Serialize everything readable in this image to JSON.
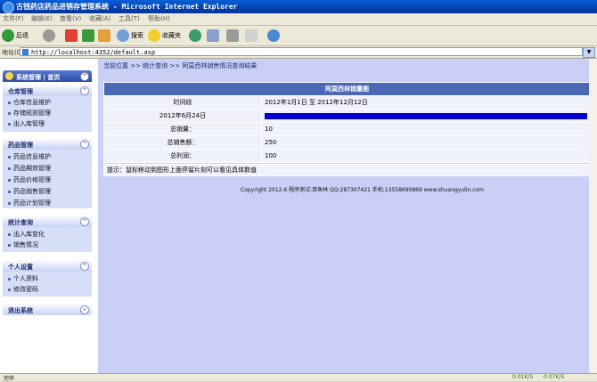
{
  "window": {
    "title": "古钱药店药品进销存管理系统 - Microsoft Internet Explorer"
  },
  "menu": [
    "文件(F)",
    "编辑(E)",
    "查看(V)",
    "收藏(A)",
    "工具(T)",
    "帮助(H)"
  ],
  "toolbar": {
    "back": "后退",
    "search": "搜索",
    "favorites": "收藏夹"
  },
  "address": {
    "label": "地址(D)",
    "url": "http://localhost:4352/default.asp"
  },
  "sidebar": {
    "top_title": "系统管理 | 首页",
    "groups": [
      {
        "title": "仓库管理",
        "items": [
          "仓库信息维护",
          "存储规则管理",
          "出入库管理"
        ]
      },
      {
        "title": "药品管理",
        "items": [
          "药品信息维护",
          "药品期效管理",
          "药品价格管理",
          "药品销售管理",
          "药品计划管理"
        ]
      },
      {
        "title": "统计查询",
        "items": [
          "出入库变化",
          "销售情况"
        ]
      },
      {
        "title": "个人设置",
        "items": [
          "个人资料",
          "修改密码"
        ]
      }
    ],
    "logout": "退出系统",
    "collapse_glyph": "«"
  },
  "main": {
    "breadcrumb": "当前位置 >> 统计查询 >> 阿莫西林销售情况查询结果",
    "table": {
      "header": "阿莫西林销量图",
      "rows": [
        {
          "label": "时间段",
          "value": "2012年1月1日 至 2012年12月12日"
        },
        {
          "label": "2012年6月24日",
          "value": ""
        },
        {
          "label": "总销量：",
          "value": "10"
        },
        {
          "label": "总销售额：",
          "value": "250"
        },
        {
          "label": "总利润：",
          "value": "100"
        }
      ]
    },
    "sales_bar_fraction": 1.0,
    "tip": "提示：鼠标移动到图形上面停留片刻可以看见具体数值",
    "copyright": "Copyright 2012.6 程序测试:双鱼林 QQ:287307421 手机:13558690869 www.shuangyulin.com"
  },
  "status": {
    "text": "完毕",
    "net_down": "0.01K/S",
    "net_up": "0.07K/S"
  },
  "colors": {
    "sidebar_body": "#d6dff7",
    "main_bg": "#c9cff5",
    "table_header": "#4b68b4",
    "bar": "#0000cc"
  }
}
